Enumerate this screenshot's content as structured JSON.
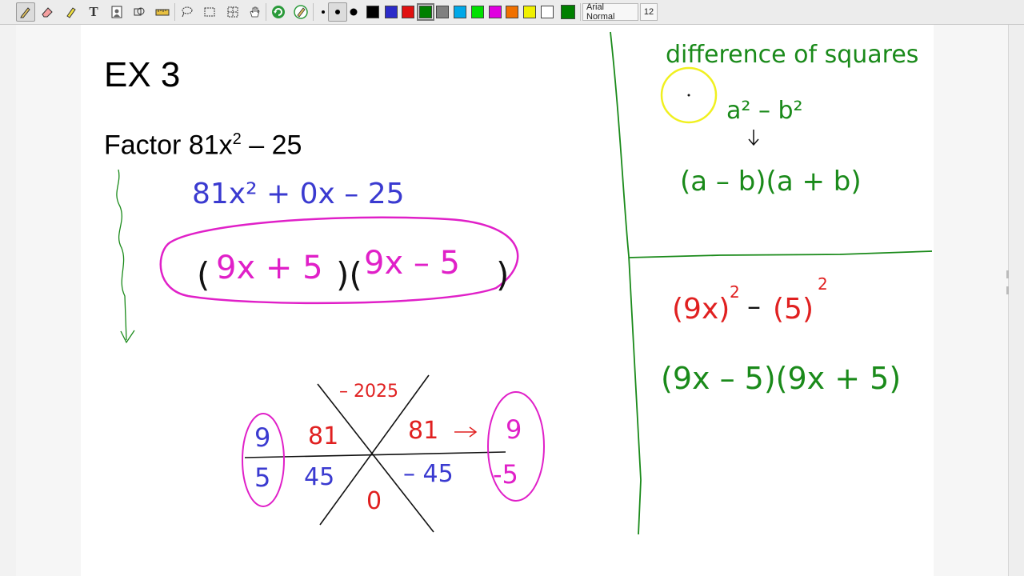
{
  "toolbar": {
    "font_name": "Arial Normal",
    "font_size": "12",
    "tools": [
      "pen-icon",
      "eraser-icon",
      "highlighter-icon",
      "text-icon",
      "insert-image-icon",
      "shapes-icon",
      "ruler-icon",
      "lasso-icon",
      "select-area-icon",
      "grid-select-icon",
      "hand-pan-icon",
      "undo-icon",
      "pen-settings-icon",
      "small-dot-icon",
      "medium-dot-icon",
      "large-dot-icon"
    ],
    "colors": [
      "#000000",
      "#2b2bc8",
      "#e01010",
      "#008000",
      "#808080",
      "#00a8e8",
      "#00e000",
      "#e000e0",
      "#f0f000",
      "#ffffff",
      "#008000"
    ]
  },
  "slide": {
    "title": "EX 3",
    "problem_word": "Factor",
    "problem_expr": "81x",
    "problem_exp": "2",
    "problem_tail": "– 25"
  },
  "ink": {
    "standard_form": "81x² + 0x  – 25",
    "factored_answer": [
      "(",
      "9x + 5",
      ")(",
      "9x – 5",
      ")"
    ],
    "x_box": {
      "top": "– 2025",
      "left_top": "81",
      "left_bottom": "45",
      "right_top": "81",
      "right_bottom": "– 45",
      "bottom": "0",
      "left_factors": [
        "9",
        "5"
      ],
      "right_factors": [
        "9",
        "-5"
      ]
    },
    "notes_title": "difference of squares",
    "formula": "a² – b²",
    "formula_factored": "(a – b)(a + b)",
    "applied_squares": [
      "(9x)",
      "2",
      "–",
      "(5)",
      "2"
    ],
    "applied_factored": "(9x – 5)(9x + 5)"
  },
  "colors": {
    "blue_ink": "#3a3ad0",
    "magenta_ink": "#e020c8",
    "red_ink": "#e02020",
    "green_ink": "#1a8a1a",
    "black_ink": "#111111",
    "cursor_highlight": "#f0f020"
  }
}
